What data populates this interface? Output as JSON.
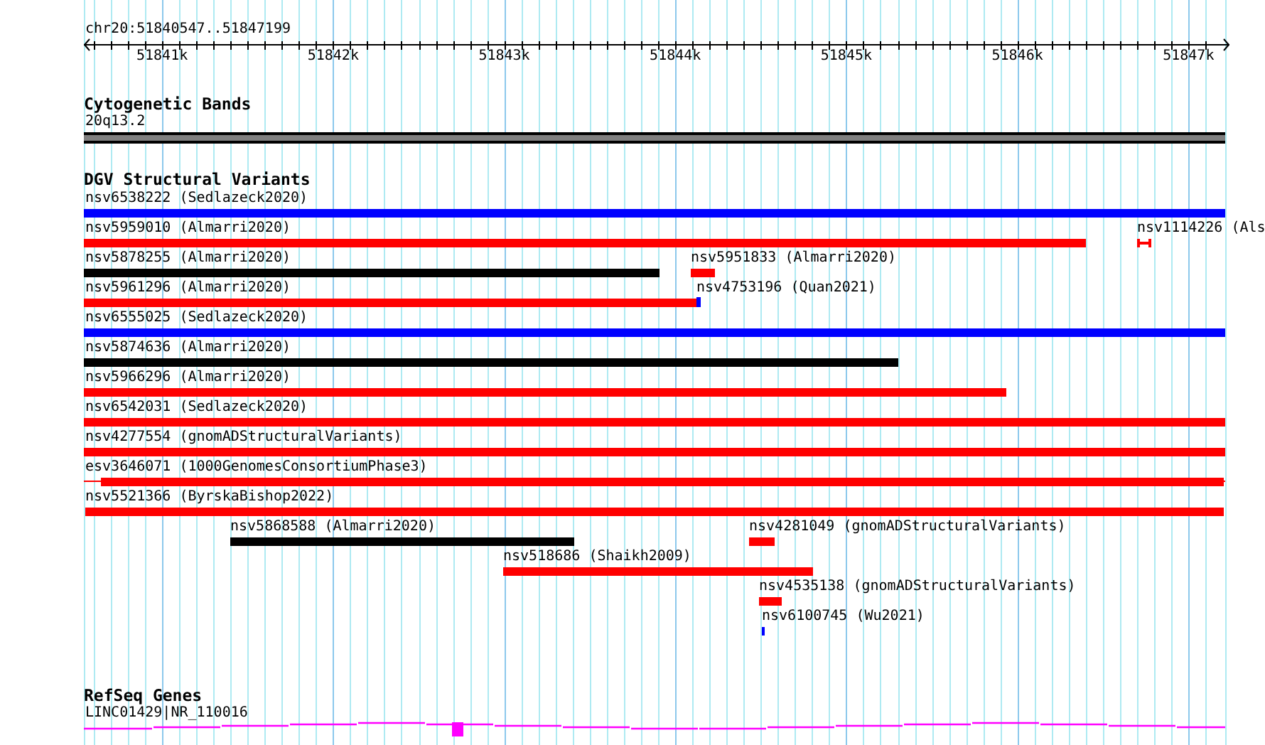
{
  "location": "chr20:51840547..51847199",
  "ruler": {
    "ticks": [
      "51841k",
      "51842k",
      "51843k",
      "51844k",
      "51845k",
      "51846k",
      "51847k"
    ]
  },
  "tracks": [
    {
      "title": "Cytogenetic Bands",
      "kind": "band",
      "features": [
        {
          "label": "20q13.2"
        }
      ]
    },
    {
      "title": "DGV Structural Variants",
      "kind": "variants",
      "features": [
        {
          "label": "nsv6538222 (Sedlazeck2020)",
          "color": "#0000ff"
        },
        {
          "label": "nsv5959010 (Almarri2020)",
          "color": "#ff0000"
        },
        {
          "label": "nsv1114226 (Als",
          "color": "#ff0000"
        },
        {
          "label": "nsv5878255 (Almarri2020)",
          "color": "#000000"
        },
        {
          "label": "nsv5951833 (Almarri2020)",
          "color": "#ff0000"
        },
        {
          "label": "nsv5961296 (Almarri2020)",
          "color": "#ff0000"
        },
        {
          "label": "nsv4753196 (Quan2021)",
          "color": "#0000ff"
        },
        {
          "label": "nsv6555025 (Sedlazeck2020)",
          "color": "#0000ff"
        },
        {
          "label": "nsv5874636 (Almarri2020)",
          "color": "#000000"
        },
        {
          "label": "nsv5966296 (Almarri2020)",
          "color": "#ff0000"
        },
        {
          "label": "nsv6542031 (Sedlazeck2020)",
          "color": "#ff0000"
        },
        {
          "label": "nsv4277554 (gnomADStructuralVariants)",
          "color": "#ff0000"
        },
        {
          "label": "esv3646071 (1000GenomesConsortiumPhase3)",
          "color": "#ff0000"
        },
        {
          "label": "nsv5521366 (ByrskaBishop2022)",
          "color": "#ff0000"
        },
        {
          "label": "nsv5868588 (Almarri2020)",
          "color": "#000000"
        },
        {
          "label": "nsv4281049 (gnomADStructuralVariants)",
          "color": "#ff0000"
        },
        {
          "label": "nsv518686 (Shaikh2009)",
          "color": "#ff0000"
        },
        {
          "label": "nsv4535138 (gnomADStructuralVariants)",
          "color": "#ff0000"
        },
        {
          "label": "nsv6100745 (Wu2021)",
          "color": "#0000ff"
        }
      ]
    },
    {
      "title": "RefSeq Genes",
      "kind": "gene",
      "features": [
        {
          "label": "LINC01429|NR_110016"
        }
      ]
    }
  ]
}
